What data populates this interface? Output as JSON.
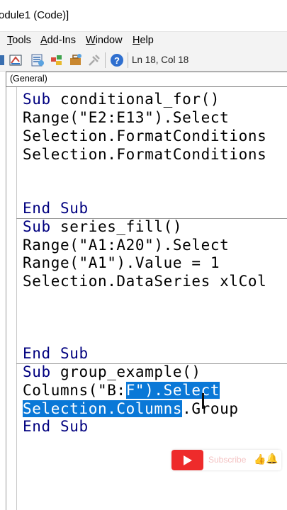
{
  "window": {
    "title": "odule1 (Code)]"
  },
  "menu": {
    "items": [
      "Tools",
      "Add-Ins",
      "Window",
      "Help"
    ]
  },
  "toolbar": {
    "icons": [
      "design-mode-icon",
      "project-explorer-icon",
      "properties-icon",
      "object-browser-icon",
      "toolbox-icon",
      "help-icon"
    ],
    "position": "Ln 18, Col 18"
  },
  "object_combo": {
    "value": "(General)"
  },
  "code": {
    "proc1": {
      "l1": [
        "Sub",
        " conditional_for()"
      ],
      "l2": "Range(\"E2:E13\").Select",
      "l3": "Selection.FormatConditions",
      "l4": "Selection.FormatConditions",
      "end": [
        "End",
        " ",
        "Sub"
      ]
    },
    "proc2": {
      "l1": [
        "Sub",
        " series_fill()"
      ],
      "l2": "Range(\"A1:A20\").Select",
      "l3": "Range(\"A1\").Value = 1",
      "l4": "Selection.DataSeries xlCol",
      "end": [
        "End",
        " ",
        "Sub"
      ]
    },
    "proc3": {
      "l1": [
        "Sub",
        " group_example()"
      ],
      "l2_plain": "Columns(\"B:",
      "l2_sel": "F\").Select",
      "l3_sel": "Selection.Columns",
      "l3_plain": ".Group",
      "end": [
        "End",
        " ",
        "Sub"
      ]
    }
  },
  "overlay": {
    "subscribe_label": "Subscribe"
  },
  "colors": {
    "keyword": "#00007f",
    "selection": "#0a78d7",
    "youtube_red": "#ee2b2b"
  }
}
